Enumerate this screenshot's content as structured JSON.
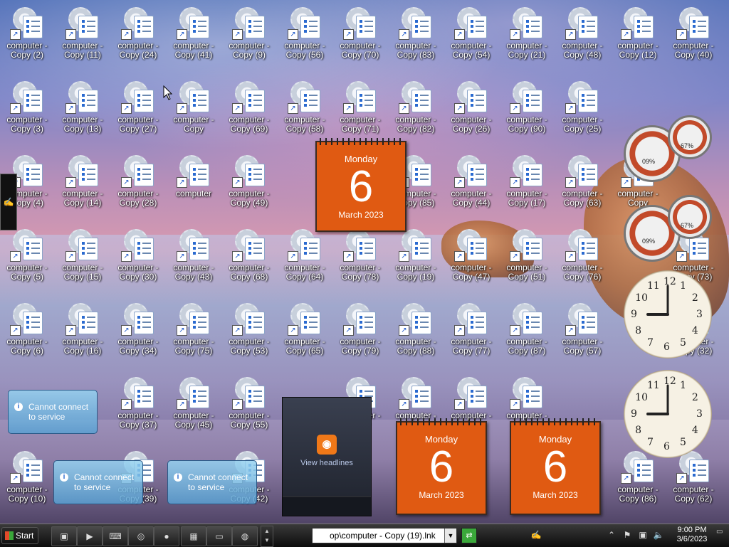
{
  "desktop": {
    "icons": [
      {
        "label": "computer -\nCopy (2)"
      },
      {
        "label": "computer -\nCopy (11)"
      },
      {
        "label": "computer -\nCopy (24)"
      },
      {
        "label": "computer -\nCopy (41)"
      },
      {
        "label": "computer -\nCopy (9)"
      },
      {
        "label": "computer -\nCopy (56)"
      },
      {
        "label": "computer -\nCopy (70)"
      },
      {
        "label": "computer -\nCopy (83)"
      },
      {
        "label": "computer -\nCopy (54)"
      },
      {
        "label": "computer -\nCopy (21)"
      },
      {
        "label": "computer -\nCopy (48)"
      },
      {
        "label": "computer -\nCopy (12)"
      },
      {
        "label": "computer -\nCopy (40)"
      },
      {
        "label": "computer -\nCopy (3)"
      },
      {
        "label": "computer -\nCopy (13)"
      },
      {
        "label": "computer -\nCopy (27)"
      },
      {
        "label": "computer -\nCopy"
      },
      {
        "label": "computer -\nCopy (69)"
      },
      {
        "label": "computer -\nCopy (58)"
      },
      {
        "label": "computer -\nCopy (71)"
      },
      {
        "label": "computer -\nCopy (82)"
      },
      {
        "label": "computer -\nCopy (26)"
      },
      {
        "label": "computer -\nCopy (90)"
      },
      {
        "label": "computer -\nCopy (25)"
      },
      {
        "label": "computer -\nCopy (4)"
      },
      {
        "label": "computer -\nCopy (14)"
      },
      {
        "label": "computer -\nCopy (28)"
      },
      {
        "label": "computer"
      },
      {
        "label": "computer -\nCopy (49)"
      },
      {
        "label": "computer -\nCopy (85)"
      },
      {
        "label": "computer -\nCopy (44)"
      },
      {
        "label": "computer -\nCopy (17)"
      },
      {
        "label": "computer -\nCopy (63)"
      },
      {
        "label": "computer -\nCopy"
      },
      {
        "label": "computer -\nCopy (5)"
      },
      {
        "label": "computer -\nCopy (15)"
      },
      {
        "label": "computer -\nCopy (30)"
      },
      {
        "label": "computer -\nCopy (43)"
      },
      {
        "label": "computer -\nCopy (68)"
      },
      {
        "label": "computer -\nCopy (64)"
      },
      {
        "label": "computer -\nCopy (78)"
      },
      {
        "label": "computer -\nCopy (19)"
      },
      {
        "label": "computer -\nCopy (47)"
      },
      {
        "label": "computer -\nCopy (51)"
      },
      {
        "label": "computer -\nCopy (76)"
      },
      {
        "label": "computer -\nCopy (73)"
      },
      {
        "label": "computer -\nCopy (6)"
      },
      {
        "label": "computer -\nCopy (16)"
      },
      {
        "label": "computer -\nCopy (34)"
      },
      {
        "label": "computer -\nCopy (75)"
      },
      {
        "label": "computer -\nCopy (53)"
      },
      {
        "label": "computer -\nCopy (65)"
      },
      {
        "label": "computer -\nCopy (79)"
      },
      {
        "label": "computer -\nCopy (88)"
      },
      {
        "label": "computer -\nCopy (77)"
      },
      {
        "label": "computer -\nCopy (87)"
      },
      {
        "label": "computer -\nCopy (57)"
      },
      {
        "label": "computer -\nCopy (32)"
      },
      {
        "label": "computer -\nCopy (37)"
      },
      {
        "label": "computer -\nCopy (45)"
      },
      {
        "label": "computer -\nCopy (55)"
      },
      {
        "label": "computer -\nCopy"
      },
      {
        "label": "computer -\nCopy"
      },
      {
        "label": "computer -\nCopy"
      },
      {
        "label": "computer -\nCopy"
      },
      {
        "label": "computer -\nCopy (10)"
      },
      {
        "label": "computer -\nCopy (39)"
      },
      {
        "label": "computer -\nCopy (42)"
      },
      {
        "label": "computer -\nCopy (86)"
      },
      {
        "label": "computer -\nCopy (62)"
      }
    ]
  },
  "gadgets": {
    "calendar": {
      "day": "Monday",
      "date": "6",
      "month_year": "March 2023"
    },
    "cpu_meter": {
      "cpu": "09%",
      "memory": "67%"
    },
    "clock_numbers": [
      "12",
      "1",
      "2",
      "3",
      "4",
      "5",
      "6",
      "7",
      "8",
      "9",
      "10",
      "11"
    ],
    "clock_time": {
      "hour": 9,
      "minute": 0
    },
    "notice": {
      "text": "Cannot connect to service"
    },
    "feed": {
      "label": "View headlines"
    }
  },
  "taskbar": {
    "start_label": "Start",
    "quick_launch": [
      "desktop-icon",
      "media-player-icon",
      "terminal-icon",
      "media-app-icon",
      "firefox-icon",
      "calculator-icon",
      "window-icon",
      "app-icon"
    ],
    "address_value": "op\\computer - Copy (19).lnk",
    "time": "9:00 PM",
    "date": "3/6/2023"
  },
  "colors": {
    "calendar": "#e05a12",
    "taskbar": "#0c0c0c",
    "notice": "#5aa0d2"
  }
}
